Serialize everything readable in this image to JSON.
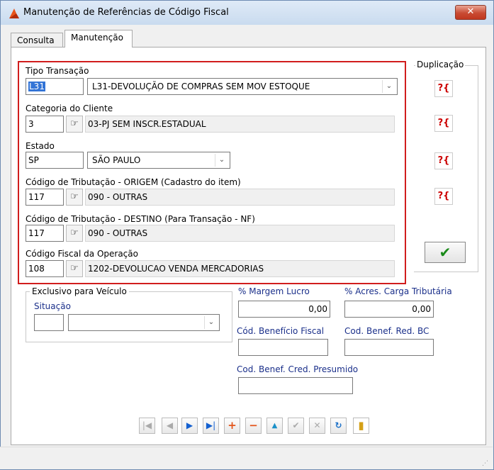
{
  "window": {
    "title": "Manutenção de Referências de Código Fiscal",
    "close": "✕"
  },
  "tabs": [
    {
      "label": "Consulta"
    },
    {
      "label": "Manutenção"
    }
  ],
  "form": {
    "tipo_transacao": {
      "label": "Tipo Transação",
      "code": "L31",
      "description": "L31-DEVOLUÇÃO DE COMPRAS SEM MOV ESTOQUE"
    },
    "categoria_cliente": {
      "label": "Categoria do Cliente",
      "code": "3",
      "description": "03-PJ SEM INSCR.ESTADUAL"
    },
    "estado": {
      "label": "Estado",
      "code": "SP",
      "description": "SÃO PAULO"
    },
    "trib_origem": {
      "label": "Código de Tributação - ORIGEM (Cadastro do item)",
      "code": "117",
      "description": "090 -  OUTRAS"
    },
    "trib_destino": {
      "label": "Código de Tributação - DESTINO (Para Transação - NF)",
      "code": "117",
      "description": "090 -  OUTRAS"
    },
    "codigo_fiscal": {
      "label": "Código Fiscal da Operação",
      "code": "108",
      "description": "1202-DEVOLUCAO VENDA MERCADORIAS"
    }
  },
  "duplicacao": {
    "label": "Duplicação",
    "button_text": "?{"
  },
  "confirm_icon": "✔",
  "veiculo": {
    "group_title": "Exclusivo para Veículo",
    "situacao_label": "Situação",
    "situacao_code": "",
    "situacao_value": ""
  },
  "margem_lucro": {
    "label": "% Margem Lucro",
    "value": "0,00"
  },
  "acres_carga": {
    "label": "% Acres. Carga Tributária",
    "value": "0,00"
  },
  "cod_beneficio_fiscal": {
    "label": "Cód. Benefício Fiscal",
    "value": ""
  },
  "cod_benef_red_bc": {
    "label": "Cod. Benef. Red. BC",
    "value": ""
  },
  "cod_benef_cred_presumido": {
    "label": "Cod. Benef. Cred. Presumido",
    "value": ""
  },
  "navigator": {
    "first": "|◀",
    "prior": "◀",
    "next": "▶",
    "last": "▶|",
    "insert": "+",
    "delete": "−",
    "edit": "▲",
    "post": "✔",
    "cancel": "✕",
    "refresh": "↻",
    "exit": "▮"
  }
}
